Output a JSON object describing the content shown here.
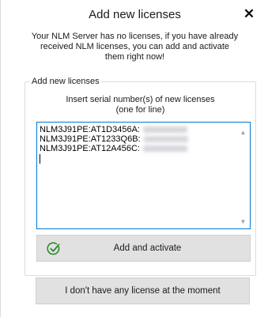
{
  "window": {
    "title": "Add new licenses"
  },
  "intro": {
    "line1": "Your NLM Server has no licenses, if you have already",
    "line2": "received NLM licenses, you can add and activate",
    "line3": "them right now!"
  },
  "group": {
    "legend": "Add new licenses",
    "instruction1": "Insert serial number(s) of new licenses",
    "instruction2": "(one for line)"
  },
  "serials": [
    "NLM3J91PE:AT1D3456A:",
    "NLM3J91PE:AT1233Q6B:",
    "NLM3J91PE:AT12A456C:"
  ],
  "buttons": {
    "add_activate": "Add and activate",
    "no_license": "I don't have any license at the moment"
  },
  "colors": {
    "accent": "#0078d7",
    "button_bg": "#e1e1e1",
    "check_icon": "#2e8b2e"
  },
  "icons": {
    "close": "close-icon",
    "check": "check-circle-icon"
  }
}
